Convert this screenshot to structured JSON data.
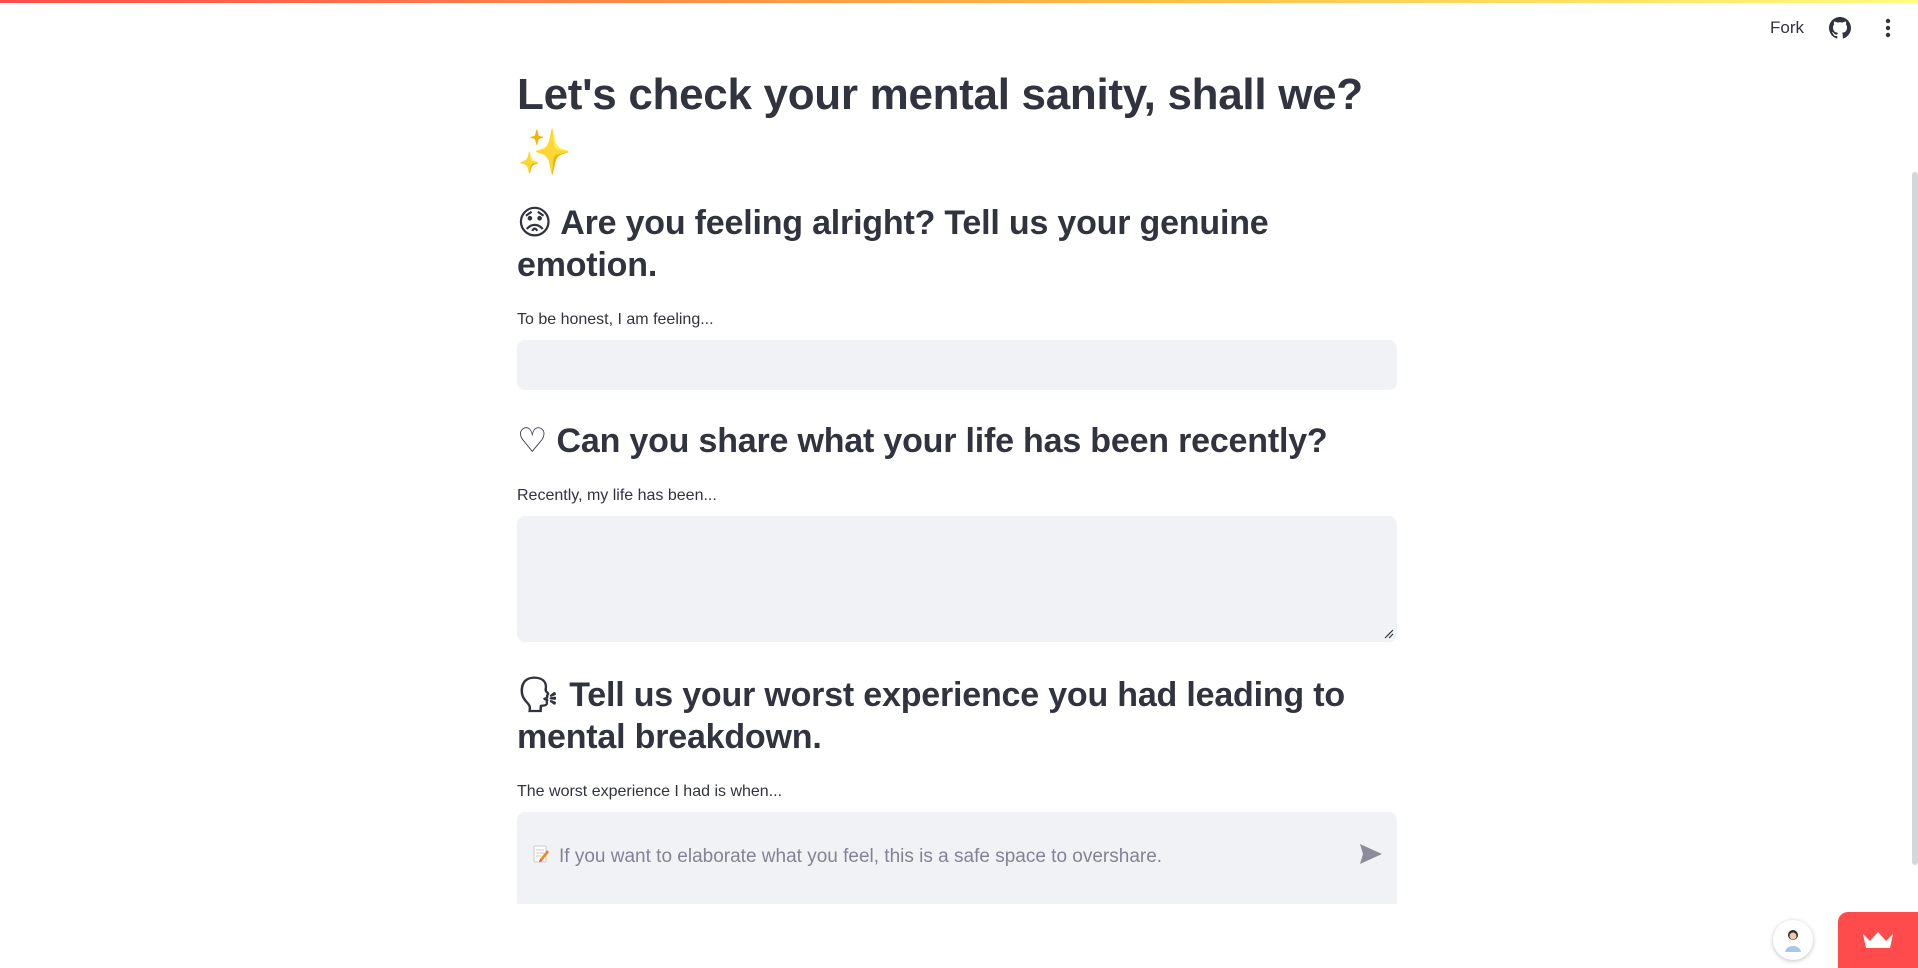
{
  "header": {
    "fork_label": "Fork",
    "icons": [
      "github-icon",
      "more-vert-icon"
    ]
  },
  "page": {
    "title": "Let's check your mental sanity, shall we? ✨"
  },
  "sections": [
    {
      "heading": "😟 Are you feeling alright? Tell us your genuine emotion.",
      "label": "To be honest, I am feeling...",
      "value": ""
    },
    {
      "heading": "♡ Can you share what your life has been recently?",
      "label": "Recently, my life has been...",
      "value": ""
    },
    {
      "heading": "🗣 Tell us your worst experience you had leading to mental breakdown.",
      "label": "The worst experience I had is when...",
      "value": ""
    }
  ],
  "chat": {
    "icon": "memo-icon",
    "placeholder": "If you want to elaborate what you feel, this is a safe space to overshare.",
    "send_icon": "send-icon"
  },
  "colors": {
    "accent": "#ff4b4b",
    "input_bg": "#f0f2f6",
    "text": "#31333F",
    "placeholder": "#808495"
  }
}
